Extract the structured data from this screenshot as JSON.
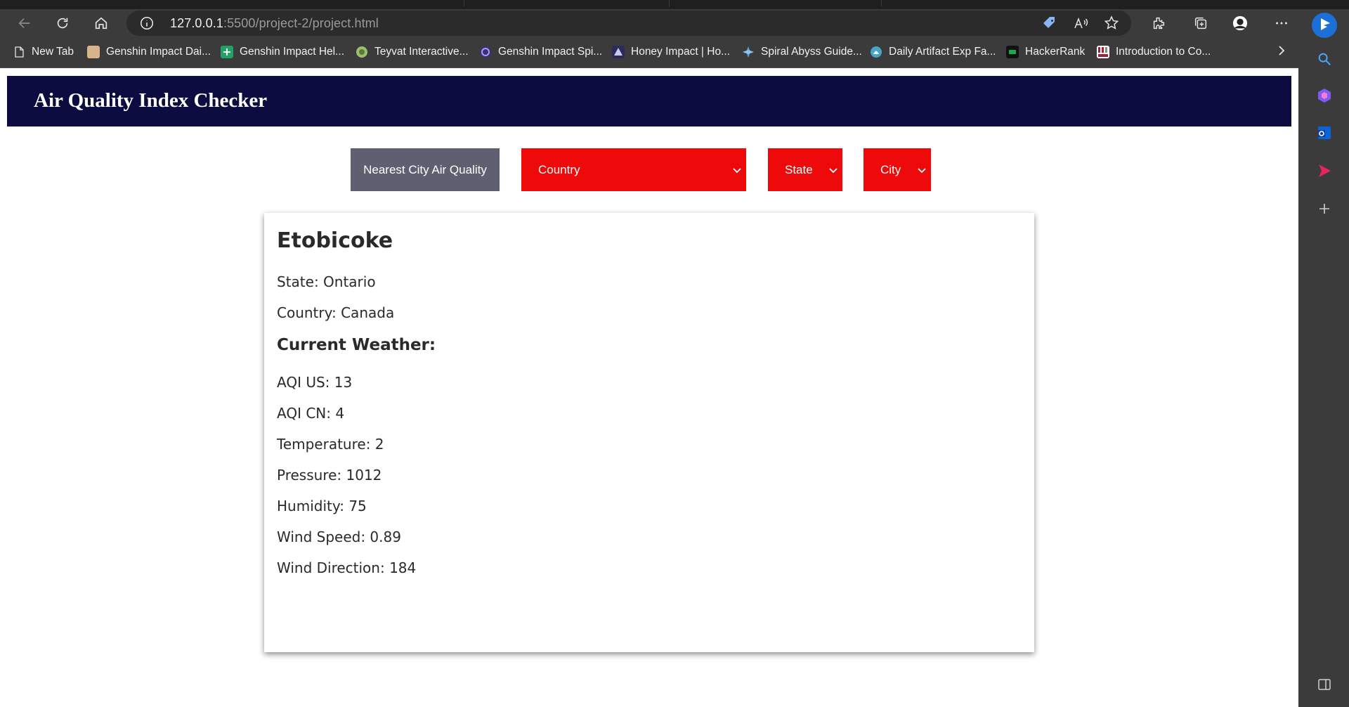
{
  "browser": {
    "url_host": "127.0.0.1",
    "url_path": ":5500/project-2/project.html",
    "bookmarks": [
      {
        "label": "New Tab",
        "icon": "page-icon",
        "color": "#ffffff"
      },
      {
        "label": "Genshin Impact Dai...",
        "icon": "genshin-icon",
        "color": "#d9b38c"
      },
      {
        "label": "Genshin Impact Hel...",
        "icon": "plus-sheet-icon",
        "color": "#21a366"
      },
      {
        "label": "Teyvat Interactive...",
        "icon": "teyvat-icon",
        "color": "#9bbf6a"
      },
      {
        "label": "Genshin Impact Spi...",
        "icon": "spiral-icon",
        "color": "#7b6cd9"
      },
      {
        "label": "Honey Impact | Ho...",
        "icon": "honey-icon",
        "color": "#4a4a8a"
      },
      {
        "label": "Spiral Abyss Guide...",
        "icon": "abyss-icon",
        "color": "#5aa0e0"
      },
      {
        "label": "Daily Artifact Exp Fa...",
        "icon": "artifact-icon",
        "color": "#4aa3c8"
      },
      {
        "label": "HackerRank",
        "icon": "hackerrank-icon",
        "color": "#1ba94c"
      },
      {
        "label": "Introduction to Co...",
        "icon": "mit-icon",
        "color": "#a31f34"
      }
    ]
  },
  "app": {
    "title": "Air Quality Index Checker",
    "nearest_button": "Nearest City Air Quality",
    "country_select": "Country",
    "state_select": "State",
    "city_select": "City",
    "accent": "#ee0a0a",
    "header_bg": "#0c0c40"
  },
  "card": {
    "city": "Etobicoke",
    "state": "State: Ontario",
    "country": "Country: Canada",
    "weather_heading": "Current Weather:",
    "aqi_us": "AQI US: 13",
    "aqi_cn": "AQI CN: 4",
    "temperature": "Temperature: 2",
    "pressure": "Pressure: 1012",
    "humidity": "Humidity: 75",
    "wind_speed": "Wind Speed: 0.89",
    "wind_direction": "Wind Direction: 184"
  }
}
